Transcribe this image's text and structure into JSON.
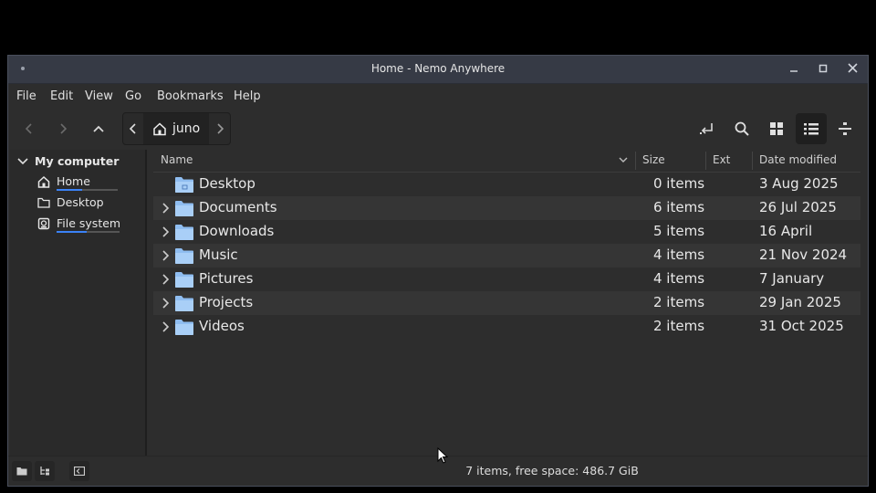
{
  "window": {
    "title": "Home - Nemo Anywhere"
  },
  "menu": [
    "File",
    "Edit",
    "View",
    "Go",
    "Bookmarks",
    "Help"
  ],
  "breadcrumb": {
    "current": "juno"
  },
  "sidebar": {
    "section": "My computer",
    "items": [
      {
        "label": "Home",
        "icon": "home-icon"
      },
      {
        "label": "Desktop",
        "icon": "folder-icon"
      },
      {
        "label": "File system",
        "icon": "drive-icon"
      }
    ]
  },
  "columns": {
    "name": "Name",
    "size": "Size",
    "ext": "Ext",
    "date": "Date modified"
  },
  "files": [
    {
      "name": "Desktop",
      "size": "0 items",
      "date": "3 Aug 2025",
      "expandable": false
    },
    {
      "name": "Documents",
      "size": "6 items",
      "date": "26 Jul 2025",
      "expandable": true
    },
    {
      "name": "Downloads",
      "size": "5 items",
      "date": "16 April",
      "expandable": true
    },
    {
      "name": "Music",
      "size": "4 items",
      "date": "21 Nov 2024",
      "expandable": true
    },
    {
      "name": "Pictures",
      "size": "4 items",
      "date": "7 January",
      "expandable": true
    },
    {
      "name": "Projects",
      "size": "2 items",
      "date": "29 Jan 2025",
      "expandable": true
    },
    {
      "name": "Videos",
      "size": "2 items",
      "date": "31 Oct 2025",
      "expandable": true
    }
  ],
  "status": {
    "text": "7 items, free space: 486.7 GiB"
  },
  "colors": {
    "accent": "#3b82f6",
    "folder": "#9ec6f5",
    "titlebar": "#363a45"
  }
}
